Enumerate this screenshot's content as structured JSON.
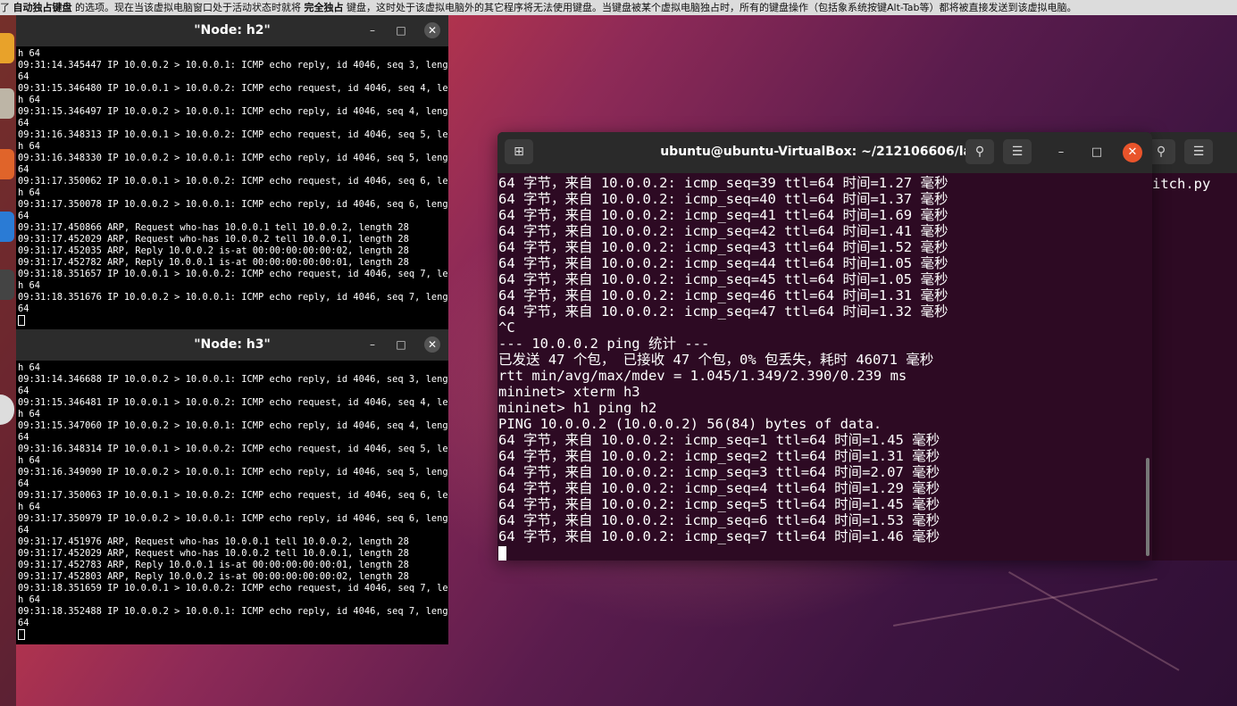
{
  "notice": {
    "prefix": "了",
    "bold1": "自动独占键盘",
    "mid": "的选项。现在当该虚拟电脑窗口处于活动状态时就将",
    "bold2": "完全独占",
    "suffix": "键盘，这时处于该虚拟电脑外的其它程序将无法使用键盘。当键盘被某个虚拟电脑独占时，所有的键盘操作（包括象系统按键Alt-Tab等）都将被直接发送到该虚拟电脑。"
  },
  "xterm_h2": {
    "title": "\"Node: h2\"",
    "lines": [
      "h 64",
      "09:31:14.345447 IP 10.0.0.2 > 10.0.0.1: ICMP echo reply, id 4046, seq 3, length",
      "64",
      "09:31:15.346480 IP 10.0.0.1 > 10.0.0.2: ICMP echo request, id 4046, seq 4, lengt",
      "h 64",
      "09:31:15.346497 IP 10.0.0.2 > 10.0.0.1: ICMP echo reply, id 4046, seq 4, length",
      "64",
      "09:31:16.348313 IP 10.0.0.1 > 10.0.0.2: ICMP echo request, id 4046, seq 5, lengt",
      "h 64",
      "09:31:16.348330 IP 10.0.0.2 > 10.0.0.1: ICMP echo reply, id 4046, seq 5, length",
      "64",
      "09:31:17.350062 IP 10.0.0.1 > 10.0.0.2: ICMP echo request, id 4046, seq 6, lengt",
      "h 64",
      "09:31:17.350078 IP 10.0.0.2 > 10.0.0.1: ICMP echo reply, id 4046, seq 6, length",
      "64",
      "09:31:17.450866 ARP, Request who-has 10.0.0.1 tell 10.0.0.2, length 28",
      "09:31:17.452029 ARP, Request who-has 10.0.0.2 tell 10.0.0.1, length 28",
      "09:31:17.452035 ARP, Reply 10.0.0.2 is-at 00:00:00:00:00:02, length 28",
      "09:31:17.452782 ARP, Reply 10.0.0.1 is-at 00:00:00:00:00:01, length 28",
      "09:31:18.351657 IP 10.0.0.1 > 10.0.0.2: ICMP echo request, id 4046, seq 7, lengt",
      "h 64",
      "09:31:18.351676 IP 10.0.0.2 > 10.0.0.1: ICMP echo reply, id 4046, seq 7, length",
      "64"
    ]
  },
  "xterm_h3": {
    "title": "\"Node: h3\"",
    "lines": [
      "h 64",
      "09:31:14.346688 IP 10.0.0.2 > 10.0.0.1: ICMP echo reply, id 4046, seq 3, length",
      "64",
      "09:31:15.346481 IP 10.0.0.1 > 10.0.0.2: ICMP echo request, id 4046, seq 4, lengt",
      "h 64",
      "09:31:15.347060 IP 10.0.0.2 > 10.0.0.1: ICMP echo reply, id 4046, seq 4, length",
      "64",
      "09:31:16.348314 IP 10.0.0.1 > 10.0.0.2: ICMP echo request, id 4046, seq 5, lengt",
      "h 64",
      "09:31:16.349090 IP 10.0.0.2 > 10.0.0.1: ICMP echo reply, id 4046, seq 5, length",
      "64",
      "09:31:17.350063 IP 10.0.0.1 > 10.0.0.2: ICMP echo request, id 4046, seq 6, lengt",
      "h 64",
      "09:31:17.350979 IP 10.0.0.2 > 10.0.0.1: ICMP echo reply, id 4046, seq 6, length",
      "64",
      "09:31:17.451976 ARP, Request who-has 10.0.0.1 tell 10.0.0.2, length 28",
      "09:31:17.452029 ARP, Request who-has 10.0.0.2 tell 10.0.0.1, length 28",
      "09:31:17.452783 ARP, Reply 10.0.0.1 is-at 00:00:00:00:00:01, length 28",
      "09:31:17.452803 ARP, Reply 10.0.0.2 is-at 00:00:00:00:00:02, length 28",
      "09:31:18.351659 IP 10.0.0.1 > 10.0.0.2: ICMP echo request, id 4046, seq 7, lengt",
      "h 64",
      "09:31:18.352488 IP 10.0.0.2 > 10.0.0.1: ICMP echo reply, id 4046, seq 7, length",
      "64"
    ]
  },
  "gterm": {
    "title": "ubuntu@ubuntu-VirtualBox: ~/212106606/lab6",
    "lines": [
      "64 字节，来自 10.0.0.2: icmp_seq=39 ttl=64 时间=1.27 毫秒",
      "64 字节，来自 10.0.0.2: icmp_seq=40 ttl=64 时间=1.37 毫秒",
      "64 字节，来自 10.0.0.2: icmp_seq=41 ttl=64 时间=1.69 毫秒",
      "64 字节，来自 10.0.0.2: icmp_seq=42 ttl=64 时间=1.41 毫秒",
      "64 字节，来自 10.0.0.2: icmp_seq=43 ttl=64 时间=1.52 毫秒",
      "64 字节，来自 10.0.0.2: icmp_seq=44 ttl=64 时间=1.05 毫秒",
      "64 字节，来自 10.0.0.2: icmp_seq=45 ttl=64 时间=1.05 毫秒",
      "64 字节，来自 10.0.0.2: icmp_seq=46 ttl=64 时间=1.31 毫秒",
      "64 字节，来自 10.0.0.2: icmp_seq=47 ttl=64 时间=1.32 毫秒",
      "^C",
      "--- 10.0.0.2 ping 统计 ---",
      "已发送 47 个包， 已接收 47 个包，0% 包丢失，耗时 46071 毫秒",
      "rtt min/avg/max/mdev = 1.045/1.349/2.390/0.239 ms",
      "mininet> xterm h3",
      "mininet> h1 ping h2",
      "PING 10.0.0.2 (10.0.0.2) 56(84) bytes of data.",
      "64 字节，来自 10.0.0.2: icmp_seq=1 ttl=64 时间=1.45 毫秒",
      "64 字节，来自 10.0.0.2: icmp_seq=2 ttl=64 时间=1.31 毫秒",
      "64 字节，来自 10.0.0.2: icmp_seq=3 ttl=64 时间=2.07 毫秒",
      "64 字节，来自 10.0.0.2: icmp_seq=4 ttl=64 时间=1.29 毫秒",
      "64 字节，来自 10.0.0.2: icmp_seq=5 ttl=64 时间=1.45 毫秒",
      "64 字节，来自 10.0.0.2: icmp_seq=6 ttl=64 时间=1.53 毫秒",
      "64 字节，来自 10.0.0.2: icmp_seq=7 ttl=64 时间=1.46 毫秒"
    ]
  },
  "bg_terminal": {
    "visible_text": "itch.py"
  },
  "icons": {
    "new_tab": "new-tab-icon",
    "search": "search-icon",
    "menu": "hamburger-menu-icon",
    "minimize": "minimize-icon",
    "maximize": "maximize-icon",
    "close": "close-icon"
  },
  "colors": {
    "terminal_bg": "#2d0a23",
    "close_button": "#e9542b",
    "xterm_bg": "#000000"
  }
}
